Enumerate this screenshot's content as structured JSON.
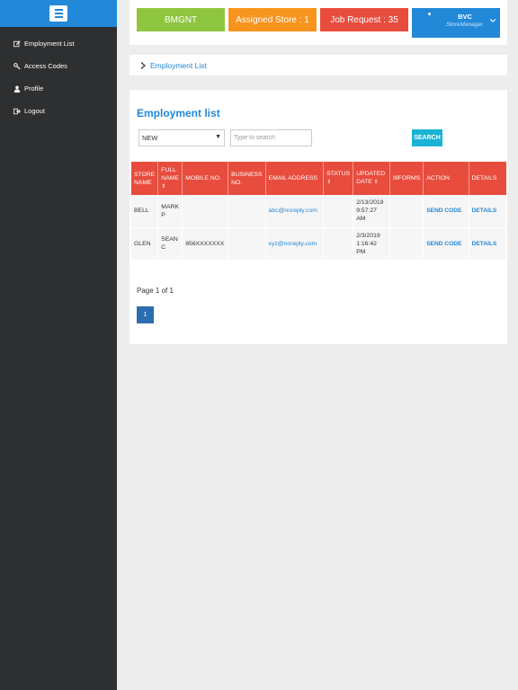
{
  "sidebar": {
    "items": [
      {
        "label": "Employment List",
        "icon": "edit-icon"
      },
      {
        "label": "Access Codes",
        "icon": "key-icon"
      },
      {
        "label": "Profile",
        "icon": "user-icon"
      },
      {
        "label": "Logout",
        "icon": "logout-icon"
      }
    ]
  },
  "header": {
    "brand": "BMGNT",
    "assigned_store": "Assigned Store : 1",
    "job_request": "Job Request : 35",
    "user_name": "BVC",
    "user_role": "StoreManager",
    "colors": {
      "green": "#8ec63f",
      "orange": "#f7941d",
      "red": "#e84c3d",
      "blue": "#2288d8"
    }
  },
  "breadcrumb": {
    "label": "Employment List"
  },
  "main": {
    "title": "Employment list",
    "filter_value": "NEW",
    "search_placeholder": "Type to search",
    "search_button": "SEARCH",
    "columns": [
      "STORE NAME",
      "FULL NAME",
      "MOBILE NO.",
      "BUSINESS NO.",
      "EMAIL ADDRESS",
      "STATUS",
      "UPDATED DATE",
      "I9FORMS",
      "ACTION",
      "DETAILS"
    ],
    "rows": [
      {
        "store": "BELL",
        "name": "MARK P",
        "mobile": "",
        "business": "",
        "email": "abc@noreply.com",
        "status": "",
        "updated": "2/13/2019 9:57:27 AM",
        "i9": "",
        "action": "SEND CODE",
        "details": "DETAILS"
      },
      {
        "store": "GLEN",
        "name": "SEAN C",
        "mobile": "856XXXXXXX",
        "business": "",
        "email": "xyz@noreply.com",
        "status": "",
        "updated": "2/3/2019 1:16:42 PM",
        "i9": "",
        "action": "SEND CODE",
        "details": "DETAILS"
      }
    ],
    "page_info": "Page 1 of 1",
    "current_page": "1"
  }
}
